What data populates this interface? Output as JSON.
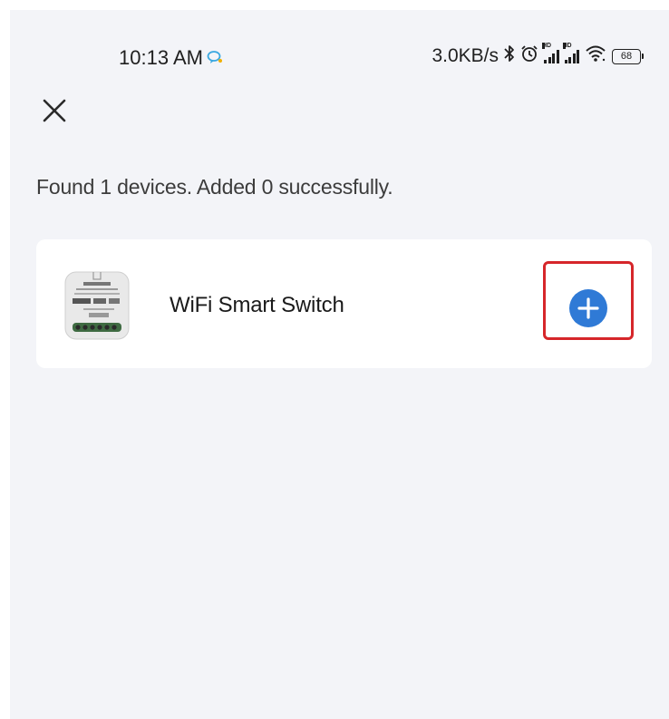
{
  "status_bar": {
    "time": "10:13 AM",
    "network_speed": "3.0KB/s",
    "battery_level": "68",
    "signal_badge": "HD",
    "icons": [
      "notification-bubble-icon",
      "bluetooth-icon",
      "alarm-icon",
      "signal-hd-icon",
      "signal-hd-icon",
      "wifi-icon",
      "battery-icon"
    ]
  },
  "header": {
    "close_icon": "close-icon"
  },
  "summary_text": "Found 1 devices. Added 0 successfully.",
  "devices": [
    {
      "name": "WiFi Smart Switch",
      "thumbnail_icon": "smart-switch-module-icon",
      "action_icon": "add-circle-icon"
    }
  ],
  "colors": {
    "background": "#f3f4f8",
    "card": "#ffffff",
    "accent": "#2f7ad6",
    "highlight": "#d6262a"
  }
}
